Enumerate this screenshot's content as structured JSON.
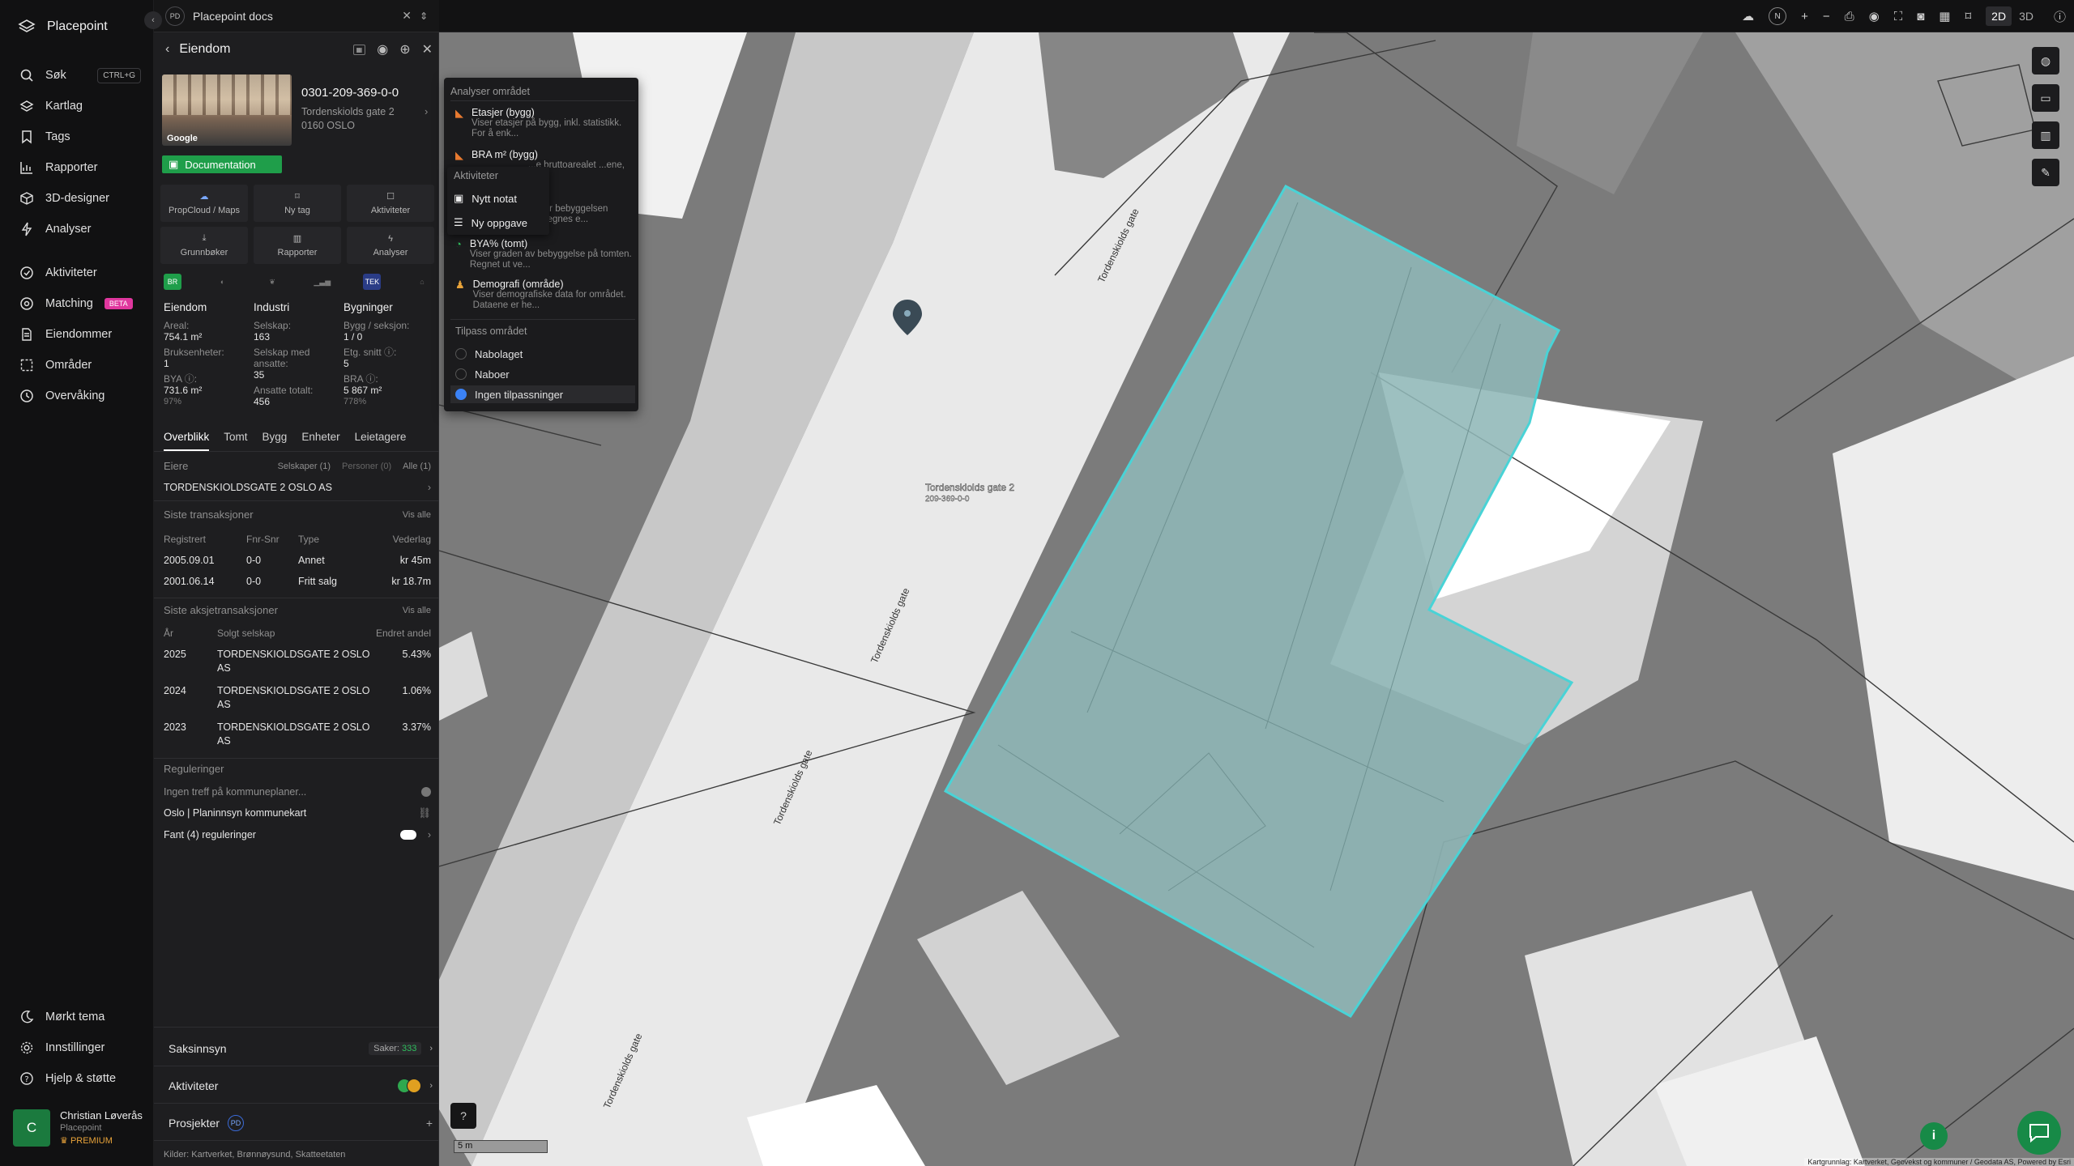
{
  "app": {
    "name": "Placepoint"
  },
  "nav": {
    "items": [
      {
        "key": "search",
        "label": "Søk",
        "shortcut": "CTRL+G"
      },
      {
        "key": "layers",
        "label": "Kartlag"
      },
      {
        "key": "tags",
        "label": "Tags"
      },
      {
        "key": "reports",
        "label": "Rapporter"
      },
      {
        "key": "designer",
        "label": "3D-designer"
      },
      {
        "key": "analyses",
        "label": "Analyser"
      }
    ],
    "items2": [
      {
        "key": "activities",
        "label": "Aktiviteter"
      },
      {
        "key": "matching",
        "label": "Matching",
        "badge": "BETA"
      },
      {
        "key": "properties",
        "label": "Eiendommer"
      },
      {
        "key": "areas",
        "label": "Områder"
      },
      {
        "key": "monitoring",
        "label": "Overvåking"
      }
    ],
    "bottom": [
      {
        "key": "dark",
        "label": "Mørkt tema"
      },
      {
        "key": "settings",
        "label": "Innstillinger"
      },
      {
        "key": "help",
        "label": "Hjelp & støtte"
      }
    ],
    "user": {
      "initial": "C",
      "name": "Christian Løverås",
      "org": "Placepoint",
      "plan": "PREMIUM"
    }
  },
  "doc_bar": {
    "badge": "PD",
    "title": "Placepoint docs"
  },
  "panel": {
    "title": "Eiendom",
    "id": "0301-209-369-0-0",
    "address_line1": "Tordenskiolds gate 2",
    "address_line2": "0160 OSLO",
    "google": "Google",
    "documentation": "Documentation",
    "quick_actions": [
      "PropCloud / Maps",
      "Ny tag",
      "Aktiviteter",
      "Grunnbøker",
      "Rapporter",
      "Analyser"
    ],
    "icon_badges": {
      "br": "BR",
      "tek": "TEK"
    },
    "facts": {
      "eiendom": {
        "title": "Eiendom",
        "areal_label": "Areal:",
        "areal": "754.1 m²",
        "bruks_label": "Bruksenheter:",
        "bruks": "1",
        "bya_label": "BYA ⓘ:",
        "bya": "731.6 m²",
        "bya_pct": "97%"
      },
      "industri": {
        "title": "Industri",
        "selskap_label": "Selskap:",
        "selskap": "163",
        "ansatte_label": "Selskap med ansatte:",
        "ansatte": "35",
        "total_label": "Ansatte totalt:",
        "total": "456"
      },
      "bygninger": {
        "title": "Bygninger",
        "bygg_label": "Bygg / seksjon:",
        "bygg": "1 / 0",
        "etg_label": "Etg. snitt ⓘ:",
        "etg": "5",
        "bra_label": "BRA ⓘ:",
        "bra": "5 867 m²",
        "bra_pct": "778%"
      }
    },
    "tabs": [
      "Overblikk",
      "Tomt",
      "Bygg",
      "Enheter",
      "Leietagere"
    ],
    "owners": {
      "title": "Eiere",
      "filters": [
        "Selskaper (1)",
        "Personer (0)",
        "Alle (1)"
      ],
      "owner": "TORDENSKIOLDSGATE 2 OSLO AS"
    },
    "transactions": {
      "title": "Siste transaksjoner",
      "see_all": "Vis alle",
      "headers": [
        "Registrert",
        "Fnr-Snr",
        "Type",
        "Vederlag"
      ],
      "rows": [
        {
          "date": "2005.09.01",
          "fnr": "0-0",
          "type": "Annet",
          "amount": "kr 45m"
        },
        {
          "date": "2001.06.14",
          "fnr": "0-0",
          "type": "Fritt salg",
          "amount": "kr 18.7m"
        }
      ]
    },
    "share_transactions": {
      "title": "Siste aksjetransaksjoner",
      "see_all": "Vis alle",
      "headers": [
        "År",
        "Solgt selskap",
        "Endret andel"
      ],
      "rows": [
        {
          "year": "2025",
          "company": "TORDENSKIOLDSGATE 2 OSLO AS",
          "share": "5.43%"
        },
        {
          "year": "2024",
          "company": "TORDENSKIOLDSGATE 2 OSLO AS",
          "share": "1.06%"
        },
        {
          "year": "2023",
          "company": "TORDENSKIOLDSGATE 2 OSLO AS",
          "share": "3.37%"
        }
      ]
    },
    "regulations": {
      "title": "Reguleringer",
      "no_hits": "Ingen treff på kommuneplaner...",
      "planinnsyn": "Oslo | Planinnsyn kommunekart",
      "found": "Fant (4) reguleringer"
    },
    "saksinnsyn": {
      "label": "Saksinnsyn",
      "count_label": "Saker:",
      "count": "333"
    },
    "aktiviteter": {
      "label": "Aktiviteter"
    },
    "prosjekter": {
      "label": "Prosjekter",
      "badge": "PD"
    },
    "sources": {
      "label": "Kilder:",
      "items": [
        "Kartverket,",
        "Brønnøysund,",
        "Skatteetaten"
      ]
    }
  },
  "analyse_menu": {
    "title": "Analyser området",
    "items": [
      {
        "title": "Etasjer (bygg)",
        "desc": "Viser etasjer på bygg, inkl. statistikk. For å enk..."
      },
      {
        "title": "BRA m² (bygg)",
        "desc": "...e bruttoarealet ...ene, i..."
      },
      {
        "title": "",
        "desc": "...er bebyggelsen ...regnes e..."
      },
      {
        "title": "BYA% (tomt)",
        "desc": "Viser graden av bebyggelse på tomten. Regnet ut ve..."
      },
      {
        "title": "Demografi (område)",
        "desc": "Viser demografiske data for området. Dataene er he..."
      }
    ],
    "adjust_title": "Tilpass området",
    "options": [
      "Nabolaget",
      "Naboer",
      "Ingen tilpassninger"
    ]
  },
  "activity_menu": {
    "title": "Aktiviteter",
    "items": [
      "Nytt notat",
      "Ny oppgave"
    ]
  },
  "map": {
    "street_name": "Tordenskiolds gate",
    "marker_label": "Tordenskiolds gate 2",
    "marker_sub": "209-369-0-0",
    "scale": "5 m",
    "attribution": "Kartgrunnlag: Kartverket, Geovekst og kommuner / Geodata AS, Powered by Esri",
    "view_modes": [
      "2D",
      "3D"
    ],
    "compass": "N",
    "highlight_color": "#49d3d6"
  }
}
